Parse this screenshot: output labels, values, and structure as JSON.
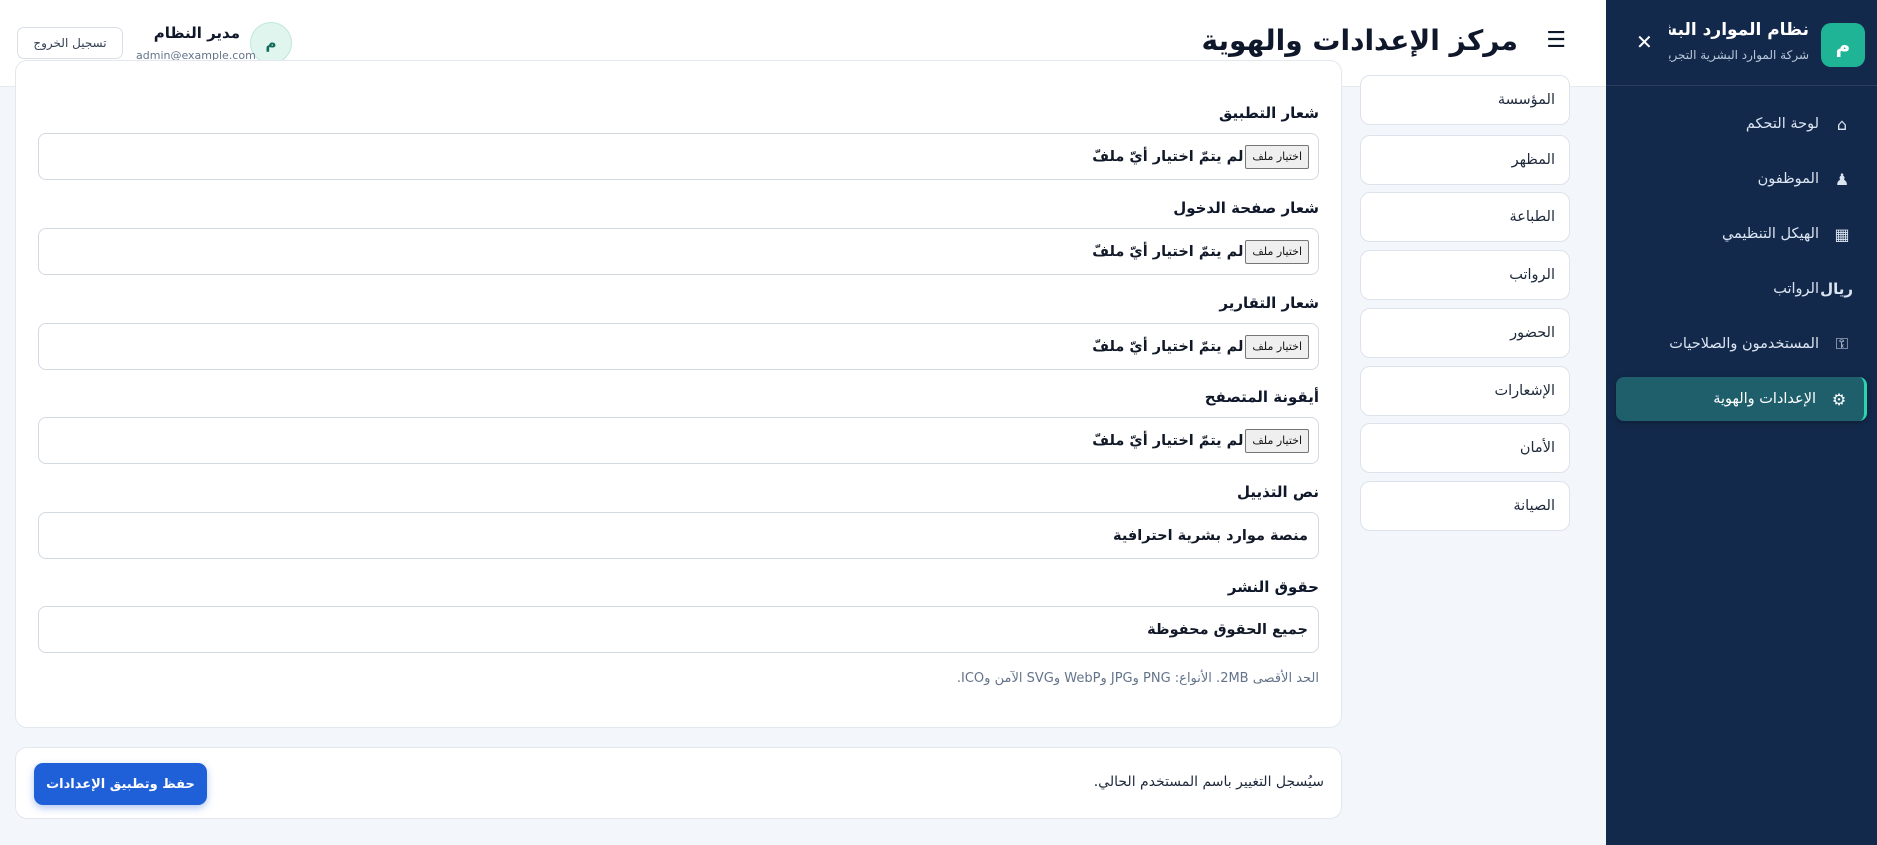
{
  "app": {
    "logo_letter": "م",
    "title": "نظام الموارد البشرية",
    "subtitle": "شركة الموارد البشرية التجريبية"
  },
  "sidebar": {
    "close_symbol": "✕",
    "items": [
      {
        "label": "لوحة التحكم",
        "icon": "⌂"
      },
      {
        "label": "الموظفون",
        "icon": "♟"
      },
      {
        "label": "الهيكل التنظيمي",
        "icon": "▦"
      },
      {
        "label": "الرواتب",
        "icon": "ريال"
      },
      {
        "label": "المستخدمون والصلاحيات",
        "icon": "⚿"
      },
      {
        "label": "الإعدادات والهوية",
        "icon": "⚙"
      }
    ]
  },
  "header": {
    "menu_symbol": "☰",
    "title": "مركز الإعدادات والهوية",
    "user": {
      "initial": "م",
      "name": "مدير النظام",
      "email": "admin@example.com"
    },
    "logout_label": "تسجيل الخروج"
  },
  "settings_nav": [
    {
      "label": "المؤسسة"
    },
    {
      "label": "المظهر"
    },
    {
      "label": "الطباعة"
    },
    {
      "label": "الرواتب"
    },
    {
      "label": "الحضور"
    },
    {
      "label": "الإشعارات"
    },
    {
      "label": "الأمان"
    },
    {
      "label": "الصيانة"
    }
  ],
  "form": {
    "file_button_label": "اختيار ملف",
    "file_fields": [
      {
        "label": "شعار التطبيق",
        "status": "لم يتمّ اختيار أيّ ملفّ"
      },
      {
        "label": "شعار صفحة الدخول",
        "status": "لم يتمّ اختيار أيّ ملفّ"
      },
      {
        "label": "شعار التقارير",
        "status": "لم يتمّ اختيار أيّ ملفّ"
      },
      {
        "label": "أيقونة المتصفح",
        "status": "لم يتمّ اختيار أيّ ملفّ"
      }
    ],
    "text_fields": [
      {
        "label": "نص التذييل",
        "value": "منصة موارد بشرية احترافية"
      },
      {
        "label": "حقوق النشر",
        "value": "جميع الحقوق محفوظة"
      }
    ],
    "hint": "الحد الأقصى 2MB. الأنواع: PNG وJPG وWebP وSVG الآمن وICO."
  },
  "save_bar": {
    "note": "سيُسجل التغيير باسم المستخدم الحالي.",
    "button_label": "حفظ وتطبيق الإعدادات"
  }
}
